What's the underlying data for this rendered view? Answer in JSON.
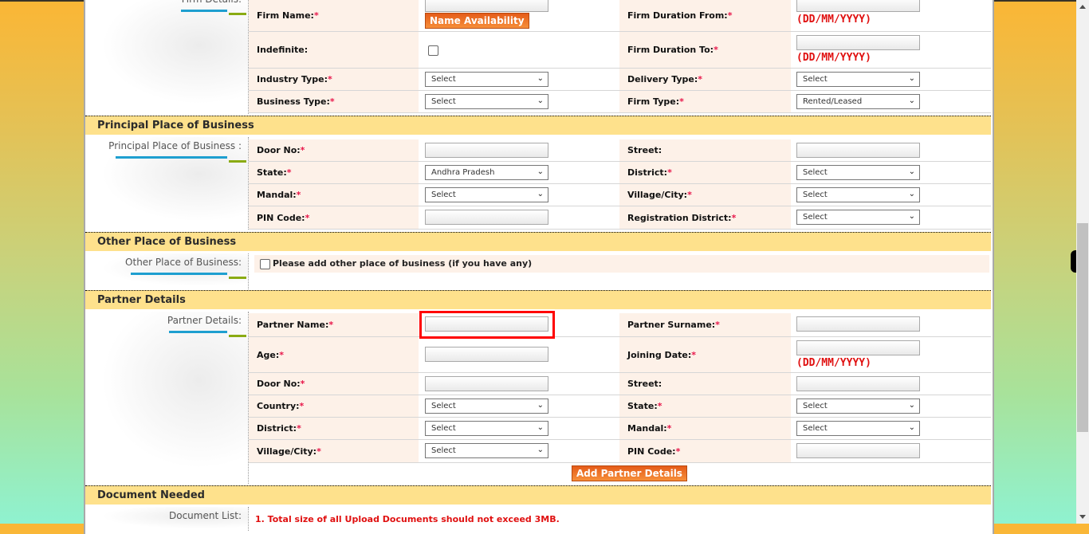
{
  "firm_details": {
    "left_label": "Firm Details:",
    "firm_name_label": "Firm Name:",
    "name_availability_button": "Name Availability",
    "firm_duration_from_label": "Firm Duration From:",
    "date_hint": "(DD/MM/YYYY)",
    "indefinite_label": "Indefinite:",
    "firm_duration_to_label": "Firm Duration To:",
    "industry_type_label": "Industry Type:",
    "industry_type_value": "Select",
    "delivery_type_label": "Delivery Type:",
    "delivery_type_value": "Select",
    "business_type_label": "Business Type:",
    "business_type_value": "Select",
    "firm_type_label": "Firm Type:",
    "firm_type_value": "Rented/Leased"
  },
  "principal_place": {
    "heading": "Principal Place of Business",
    "left_label": "Principal Place of Business :",
    "door_no_label": "Door No:",
    "street_label": "Street:",
    "state_label": "State:",
    "state_value": "Andhra Pradesh",
    "district_label": "District:",
    "district_value": "Select",
    "mandal_label": "Mandal:",
    "mandal_value": "Select",
    "village_label": "Village/City:",
    "village_value": "Select",
    "pin_label": "PIN Code:",
    "reg_district_label": "Registration District:",
    "reg_district_value": "Select"
  },
  "other_place": {
    "heading": "Other Place of Business",
    "left_label": "Other Place of Business:",
    "checkbox_label": "Please add other place of business (if you have any)"
  },
  "partner": {
    "heading": "Partner Details",
    "left_label": "Partner Details:",
    "name_label": "Partner Name:",
    "surname_label": "Partner Surname:",
    "age_label": "Age:",
    "joining_date_label": "Joining Date:",
    "date_hint": "(DD/MM/YYYY)",
    "door_no_label": "Door No:",
    "street_label": "Street:",
    "country_label": "Country:",
    "country_value": "Select",
    "state_label": "State:",
    "state_value": "Select",
    "district_label": "District:",
    "district_value": "Select",
    "mandal_label": "Mandal:",
    "mandal_value": "Select",
    "village_label": "Village/City:",
    "village_value": "Select",
    "pin_label": "PIN Code:",
    "add_button": "Add Partner Details"
  },
  "documents": {
    "heading": "Document Needed",
    "left_label": "Document List:",
    "note": "1. Total size of all Upload Documents should not exceed 3MB."
  },
  "required_marker": "*",
  "chevron_glyph": "❯",
  "colors": {
    "section_header": "#fee18c",
    "label_bg": "#fdf1e8",
    "button_orange": "#ef7a2c",
    "required_red": "#e8174a",
    "highlight_red": "#ff0000"
  }
}
